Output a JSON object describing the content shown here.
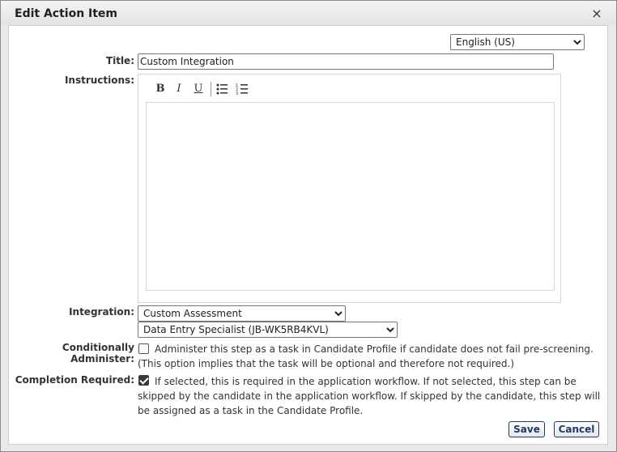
{
  "dialog": {
    "title": "Edit Action Item",
    "close_glyph": "×"
  },
  "language": {
    "selected": "English (US)"
  },
  "form": {
    "title_label": "Title:",
    "title_value": "Custom Integration",
    "instructions_label": "Instructions:",
    "instructions_value": "",
    "integration_label": "Integration:",
    "integration_selected": "Custom Assessment",
    "assessment_selected": "Data Entry Specialist (JB-WK5RB4KVL)",
    "conditionally_label": "Conditionally Administer:",
    "conditionally_checked": false,
    "conditionally_text": "Administer this step as a task in Candidate Profile if candidate does not fail pre-screening. (This option implies that the task will be optional and therefore not required.)",
    "completion_label": "Completion Required:",
    "completion_checked": true,
    "completion_text": "If selected, this is required in the application workflow. If not selected, this step can be skipped by the candidate in the application workflow. If skipped by the candidate, this step will be assigned as a task in the Candidate Profile."
  },
  "toolbar": {
    "bold": "B",
    "italic": "I",
    "underline": "U",
    "bullet_list_icon": "bullet-list-icon",
    "numbered_list_icon": "numbered-list-icon"
  },
  "buttons": {
    "save": "Save",
    "cancel": "Cancel"
  },
  "colors": {
    "button_text": "#1f3a6b",
    "dialog_bg": "#e9e9e9",
    "content_bg": "#ffffff"
  }
}
